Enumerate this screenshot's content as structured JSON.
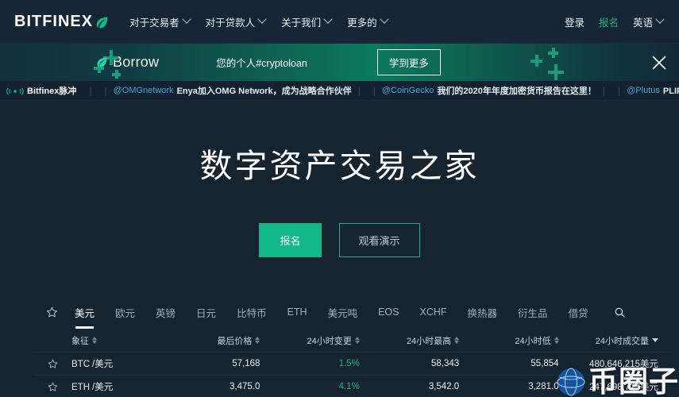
{
  "brand": {
    "name": "BITFINEX",
    "logo_icon": "leaf-icon"
  },
  "topnav": {
    "links": [
      {
        "label": "对于交易者",
        "icon": "chevron-down-icon"
      },
      {
        "label": "对于贷款人",
        "icon": "chevron-down-icon"
      },
      {
        "label": "关于我们",
        "icon": "chevron-down-icon"
      },
      {
        "label": "更多的",
        "icon": "chevron-down-icon"
      }
    ],
    "right": {
      "login": "登录",
      "signup": "报名",
      "language": "英语",
      "language_icon": "chevron-down-icon"
    }
  },
  "promo": {
    "logo_icon": "leaf-icon",
    "logo_text": "Borrow",
    "tagline": "您的个人#cryptoloan",
    "button_label": "学到更多",
    "close_icon": "close-icon",
    "decoration_icon": "plus-sparkle-icon"
  },
  "ticker": {
    "icon": "pulse-icon",
    "brand": "Bitfinex脉冲",
    "items": [
      {
        "handle": "@OMGnetwork",
        "text": "Enya加入OMG Network，成为战略合作伙伴"
      },
      {
        "handle": "@CoinGecko",
        "text": "我们的2020年年度加密货币报告在这里！"
      },
      {
        "handle": "@Plutus",
        "text": "PLIP | Pluton流动"
      }
    ]
  },
  "hero": {
    "title": "数字资产交易之家",
    "primary_button": "报名",
    "secondary_button": "观看演示"
  },
  "market": {
    "star_tab_icon": "star-icon",
    "search_icon": "search-icon",
    "tabs": [
      {
        "label": "美元",
        "active": true
      },
      {
        "label": "欧元",
        "active": false
      },
      {
        "label": "英镑",
        "active": false
      },
      {
        "label": "日元",
        "active": false
      },
      {
        "label": "比特币",
        "active": false
      },
      {
        "label": "ETH",
        "active": false
      },
      {
        "label": "美元吨",
        "active": false
      },
      {
        "label": "EOS",
        "active": false
      },
      {
        "label": "XCHF",
        "active": false
      },
      {
        "label": "换热器",
        "active": false
      },
      {
        "label": "衍生品",
        "active": false
      },
      {
        "label": "借贷",
        "active": false
      }
    ],
    "columns": [
      {
        "label": "象征",
        "sort": "both"
      },
      {
        "label": "最后价格",
        "sort": "both"
      },
      {
        "label": "24小时变更",
        "sort": "both"
      },
      {
        "label": "24小时最高",
        "sort": "both"
      },
      {
        "label": "24小时低",
        "sort": "both"
      },
      {
        "label": "24小时成交量",
        "sort": "desc"
      }
    ],
    "rows": [
      {
        "star_icon": "star-icon",
        "base": "BTC",
        "quote": "/美元",
        "last_price": "57,168",
        "change_24h": "1.5%",
        "high_24h": "58,343",
        "low_24h": "55,854",
        "volume_24h": "480,646,215",
        "volume_unit": "美元"
      },
      {
        "star_icon": "star-icon",
        "base": "ETH",
        "quote": "/美元",
        "last_price": "3,475.0",
        "change_24h": "4.1%",
        "high_24h": "3,542.0",
        "low_24h": "3,281.0",
        "volume_24h": "247,698,723",
        "volume_unit": "美元"
      }
    ]
  },
  "watermark": {
    "text": "币圈子",
    "icon": "globe-icon"
  },
  "colors": {
    "page_bg": "#16242f",
    "nav_bg": "#172634",
    "accent_green": "#12b886",
    "signup_green": "#16b589",
    "handle_blue": "#3ea8d8",
    "ticker_bg": "#132130"
  }
}
